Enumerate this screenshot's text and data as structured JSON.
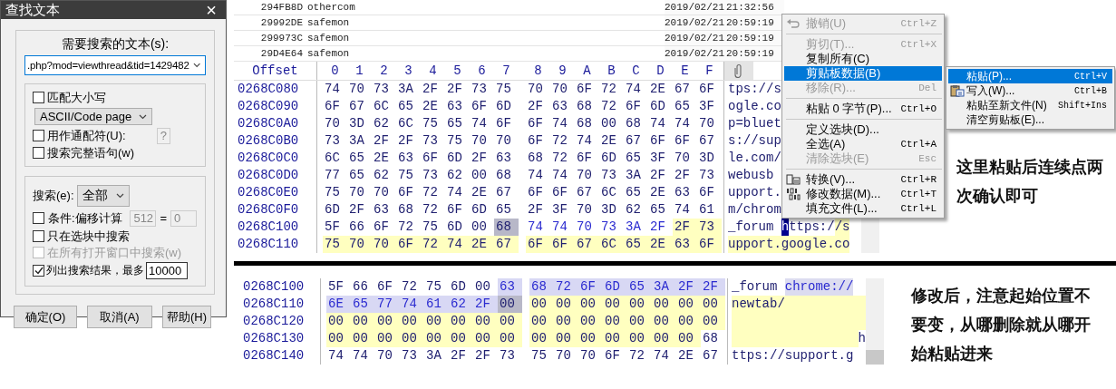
{
  "find_dialog": {
    "title": "查找文本",
    "close": "×",
    "search_label": "需要搜索的文本(s):",
    "search_value": ".php?mod=viewthread&tid=1429482",
    "options": [
      {
        "kind": "checkbox",
        "label": "匹配大小写",
        "checked": false
      },
      {
        "kind": "select",
        "value": "ASCII/Code page"
      },
      {
        "kind": "checkbox_field",
        "label": "用作通配符(U):",
        "checked": false,
        "field": "?"
      },
      {
        "kind": "checkbox",
        "label": "搜索完整语句(w)",
        "checked": false
      }
    ],
    "search_scope": {
      "label": "搜索(e):",
      "value": "全部"
    },
    "scope_options": [
      {
        "kind": "offset",
        "label": "条件:偏移计算",
        "checked": false,
        "disabled": false,
        "field": "512",
        "equals": "=",
        "field2": "0"
      },
      {
        "kind": "checkbox",
        "label": "只在选块中搜索",
        "checked": false,
        "disabled": false
      },
      {
        "kind": "checkbox",
        "label": "在所有打开窗口中搜索(w)",
        "checked": false,
        "disabled": true
      },
      {
        "kind": "limit",
        "label": "列出搜索结果，最多",
        "checked": true,
        "disabled": false,
        "field": "10000"
      }
    ],
    "buttons": [
      "确定(O)",
      "取消(A)",
      "帮助(H)"
    ]
  },
  "hex_top": {
    "results": [
      {
        "offset": "294FB8D",
        "name": "othercom",
        "date": "2019/02/21",
        "time": "21:32:56"
      },
      {
        "offset": "29992DE",
        "name": "safemon",
        "date": "2019/02/21",
        "time": "20:59:19"
      },
      {
        "offset": "299973C",
        "name": "safemon",
        "date": "2019/02/21",
        "time": "20:59:19"
      },
      {
        "offset": "29D4E64",
        "name": "safemon",
        "date": "2019/02/21",
        "time": "20:59:19"
      }
    ],
    "header": {
      "offset": "Offset",
      "columns": [
        "0",
        "1",
        "2",
        "3",
        "4",
        "5",
        "6",
        "7",
        "8",
        "9",
        "A",
        "B",
        "C",
        "D",
        "E",
        "F"
      ]
    },
    "rows": [
      {
        "offset": "0268C080",
        "bytes": [
          "74",
          "70",
          "73",
          "3A",
          "2F",
          "2F",
          "73",
          "75",
          "70",
          "70",
          "6F",
          "72",
          "74",
          "2E",
          "67",
          "6F"
        ],
        "text": [
          {
            "text": "tps://s",
            "kind": "plain"
          }
        ]
      },
      {
        "offset": "0268C090",
        "bytes": [
          "6F",
          "67",
          "6C",
          "65",
          "2E",
          "63",
          "6F",
          "6D",
          "2F",
          "63",
          "68",
          "72",
          "6F",
          "6D",
          "65",
          "3F"
        ],
        "text": [
          {
            "text": "ogle.co",
            "kind": "plain"
          }
        ]
      },
      {
        "offset": "0268C0A0",
        "bytes": [
          "70",
          "3D",
          "62",
          "6C",
          "75",
          "65",
          "74",
          "6F",
          "6F",
          "74",
          "68",
          "00",
          "68",
          "74",
          "74",
          "70"
        ],
        "text": [
          {
            "text": "p=bluet",
            "kind": "plain"
          }
        ]
      },
      {
        "offset": "0268C0B0",
        "bytes": [
          "73",
          "3A",
          "2F",
          "2F",
          "73",
          "75",
          "70",
          "70",
          "6F",
          "72",
          "74",
          "2E",
          "67",
          "6F",
          "6F",
          "67"
        ],
        "text": [
          {
            "text": "s://sup",
            "kind": "plain"
          }
        ]
      },
      {
        "offset": "0268C0C0",
        "bytes": [
          "6C",
          "65",
          "2E",
          "63",
          "6F",
          "6D",
          "2F",
          "63",
          "68",
          "72",
          "6F",
          "6D",
          "65",
          "3F",
          "70",
          "3D"
        ],
        "text": [
          {
            "text": "le.com/",
            "kind": "plain"
          }
        ]
      },
      {
        "offset": "0268C0D0",
        "bytes": [
          "77",
          "65",
          "62",
          "75",
          "73",
          "62",
          "00",
          "68",
          "74",
          "74",
          "70",
          "73",
          "3A",
          "2F",
          "2F",
          "73"
        ],
        "text": [
          {
            "text": "webusb",
            "kind": "plain"
          }
        ]
      },
      {
        "offset": "0268C0E0",
        "bytes": [
          "75",
          "70",
          "70",
          "6F",
          "72",
          "74",
          "2E",
          "67",
          "6F",
          "6F",
          "67",
          "6C",
          "65",
          "2E",
          "63",
          "6F"
        ],
        "text": [
          {
            "text": "upport.",
            "kind": "plain"
          }
        ]
      },
      {
        "offset": "0268C0F0",
        "bytes": [
          "6D",
          "2F",
          "63",
          "68",
          "72",
          "6F",
          "6D",
          "65",
          "2F",
          "3F",
          "70",
          "3D",
          "62",
          "65",
          "74",
          "61"
        ],
        "text": [
          {
            "text": "m/chrom",
            "kind": "plain"
          }
        ]
      },
      {
        "offset": "0268C100",
        "cells": [
          {
            "value": "5F",
            "kind": "plain"
          },
          {
            "value": "66",
            "kind": "plain"
          },
          {
            "value": "6F",
            "kind": "plain"
          },
          {
            "value": "72",
            "kind": "plain"
          },
          {
            "value": "75",
            "kind": "plain"
          },
          {
            "value": "6D",
            "kind": "plain"
          },
          {
            "value": "00",
            "kind": "plain"
          },
          {
            "value": "68",
            "kind": "cursor"
          },
          {
            "value": "74",
            "kind": "marked"
          },
          {
            "value": "74",
            "kind": "marked"
          },
          {
            "value": "70",
            "kind": "marked"
          },
          {
            "value": "73",
            "kind": "marked"
          },
          {
            "value": "3A",
            "kind": "marked"
          },
          {
            "value": "2F",
            "kind": "marked"
          },
          {
            "value": "2F",
            "kind": "modified"
          },
          {
            "value": "73",
            "kind": "modified"
          }
        ],
        "text": [
          {
            "text": "_forum ",
            "kind": "plain"
          },
          {
            "text": "h",
            "kind": "cursor"
          },
          {
            "text": "ttps:/",
            "kind": "plain"
          },
          {
            "text": "/s",
            "kind": "modified"
          }
        ]
      },
      {
        "offset": "0268C110",
        "cells": [
          {
            "value": "75",
            "kind": "modified"
          },
          {
            "value": "70",
            "kind": "modified"
          },
          {
            "value": "70",
            "kind": "modified"
          },
          {
            "value": "6F",
            "kind": "modified"
          },
          {
            "value": "72",
            "kind": "modified"
          },
          {
            "value": "74",
            "kind": "modified"
          },
          {
            "value": "2E",
            "kind": "modified"
          },
          {
            "value": "67",
            "kind": "modified"
          },
          {
            "value": "6F",
            "kind": "modified"
          },
          {
            "value": "6F",
            "kind": "modified"
          },
          {
            "value": "67",
            "kind": "modified"
          },
          {
            "value": "6C",
            "kind": "modified"
          },
          {
            "value": "65",
            "kind": "modified"
          },
          {
            "value": "2E",
            "kind": "modified"
          },
          {
            "value": "63",
            "kind": "modified"
          },
          {
            "value": "6F",
            "kind": "modified"
          }
        ],
        "text": [
          {
            "text": "upport.google.co",
            "kind": "modified"
          }
        ]
      }
    ],
    "note": "这里粘贴后连续点两次确认即可"
  },
  "context_menu": {
    "items": [
      {
        "kind": "undo",
        "label": "撤销(U)",
        "shortcut": "Ctrl+Z",
        "disabled": true,
        "selected": false
      },
      {
        "kind": "separator"
      },
      {
        "kind": "item",
        "label": "剪切(T)...",
        "shortcut": "Ctrl+X",
        "disabled": true,
        "selected": false
      },
      {
        "kind": "item",
        "label": "复制所有(C)",
        "disabled": false,
        "selected": false
      },
      {
        "kind": "item",
        "label": "剪贴板数据(B)",
        "disabled": false,
        "selected": true
      },
      {
        "kind": "item",
        "label": "移除(R)...",
        "shortcut": "Del",
        "disabled": true,
        "selected": false
      },
      {
        "kind": "separator"
      },
      {
        "kind": "item",
        "label": "粘贴 0 字节(P)...",
        "shortcut": "Ctrl+O",
        "disabled": false,
        "selected": false
      },
      {
        "kind": "separator"
      },
      {
        "kind": "item",
        "label": "定义选块(D)...",
        "disabled": false,
        "selected": false
      },
      {
        "kind": "item",
        "label": "全选(A)",
        "shortcut": "Ctrl+A",
        "disabled": false,
        "selected": false
      },
      {
        "kind": "item",
        "label": "清除选块(E)",
        "shortcut": "Esc",
        "disabled": true,
        "selected": false
      },
      {
        "kind": "separator"
      },
      {
        "kind": "convert",
        "label": "转换(V)...",
        "shortcut": "Ctrl+R",
        "disabled": false,
        "selected": false
      },
      {
        "kind": "modify",
        "label": "修改数据(M)...",
        "shortcut": "Ctrl+T",
        "disabled": false,
        "selected": false
      },
      {
        "kind": "item",
        "label": "填充文件(L)...",
        "shortcut": "Ctrl+L",
        "disabled": false,
        "selected": false
      }
    ]
  },
  "clipboard_submenu": {
    "items": [
      {
        "kind": "item",
        "label": "粘贴(P)...",
        "shortcut": "Ctrl+V",
        "disabled": false,
        "selected": true
      },
      {
        "kind": "write",
        "label": "写入(W)...",
        "shortcut": "Ctrl+B",
        "disabled": false,
        "selected": false
      },
      {
        "kind": "item",
        "label": "粘贴至新文件(N)",
        "shortcut": "Shift+Ins",
        "disabled": false,
        "selected": false
      },
      {
        "kind": "item",
        "label": "清空剪贴板(E)...",
        "disabled": false,
        "selected": false
      }
    ]
  },
  "hex_bottom": {
    "rows": [
      {
        "offset": "0268C100",
        "cells": [
          {
            "value": "5F",
            "kind": "plain"
          },
          {
            "value": "66",
            "kind": "plain"
          },
          {
            "value": "6F",
            "kind": "plain"
          },
          {
            "value": "72",
            "kind": "plain"
          },
          {
            "value": "75",
            "kind": "plain"
          },
          {
            "value": "6D",
            "kind": "plain"
          },
          {
            "value": "00",
            "kind": "plain"
          },
          {
            "value": "63",
            "kind": "selected"
          },
          {
            "value": "68",
            "kind": "selected"
          },
          {
            "value": "72",
            "kind": "selected"
          },
          {
            "value": "6F",
            "kind": "selected"
          },
          {
            "value": "6D",
            "kind": "selected"
          },
          {
            "value": "65",
            "kind": "selected"
          },
          {
            "value": "3A",
            "kind": "selected"
          },
          {
            "value": "2F",
            "kind": "selected"
          },
          {
            "value": "2F",
            "kind": "selected"
          }
        ],
        "text": [
          {
            "text": "_forum ",
            "kind": "plain"
          },
          {
            "text": "chrome://",
            "kind": "selected"
          }
        ]
      },
      {
        "offset": "0268C110",
        "cells": [
          {
            "value": "6E",
            "kind": "selected"
          },
          {
            "value": "65",
            "kind": "selected"
          },
          {
            "value": "77",
            "kind": "selected"
          },
          {
            "value": "74",
            "kind": "selected"
          },
          {
            "value": "61",
            "kind": "selected"
          },
          {
            "value": "62",
            "kind": "selected"
          },
          {
            "value": "2F",
            "kind": "selected"
          },
          {
            "value": "00",
            "kind": "cursor"
          },
          {
            "value": "00",
            "kind": "modified"
          },
          {
            "value": "00",
            "kind": "modified"
          },
          {
            "value": "00",
            "kind": "modified"
          },
          {
            "value": "00",
            "kind": "modified"
          },
          {
            "value": "00",
            "kind": "modified"
          },
          {
            "value": "00",
            "kind": "modified"
          },
          {
            "value": "00",
            "kind": "modified"
          },
          {
            "value": "00",
            "kind": "modified"
          }
        ],
        "text": [
          {
            "text": "newtab/",
            "kind": "modified"
          }
        ],
        "fill": {
          "kind": "after"
        }
      },
      {
        "offset": "0268C120",
        "cells": [
          {
            "value": "00",
            "kind": "modified"
          },
          {
            "value": "00",
            "kind": "modified"
          },
          {
            "value": "00",
            "kind": "modified"
          },
          {
            "value": "00",
            "kind": "modified"
          },
          {
            "value": "00",
            "kind": "modified"
          },
          {
            "value": "00",
            "kind": "modified"
          },
          {
            "value": "00",
            "kind": "modified"
          },
          {
            "value": "00",
            "kind": "modified"
          },
          {
            "value": "00",
            "kind": "modified"
          },
          {
            "value": "00",
            "kind": "modified"
          },
          {
            "value": "00",
            "kind": "modified"
          },
          {
            "value": "00",
            "kind": "modified"
          },
          {
            "value": "00",
            "kind": "modified"
          },
          {
            "value": "00",
            "kind": "modified"
          },
          {
            "value": "00",
            "kind": "modified"
          },
          {
            "value": "00",
            "kind": "modified"
          }
        ],
        "fill": {
          "kind": "full"
        }
      },
      {
        "offset": "0268C130",
        "cells": [
          {
            "value": "00",
            "kind": "modified"
          },
          {
            "value": "00",
            "kind": "modified"
          },
          {
            "value": "00",
            "kind": "modified"
          },
          {
            "value": "00",
            "kind": "modified"
          },
          {
            "value": "00",
            "kind": "modified"
          },
          {
            "value": "00",
            "kind": "modified"
          },
          {
            "value": "00",
            "kind": "modified"
          },
          {
            "value": "00",
            "kind": "modified"
          },
          {
            "value": "00",
            "kind": "modified"
          },
          {
            "value": "00",
            "kind": "modified"
          },
          {
            "value": "00",
            "kind": "modified"
          },
          {
            "value": "00",
            "kind": "modified"
          },
          {
            "value": "00",
            "kind": "modified"
          },
          {
            "value": "00",
            "kind": "modified"
          },
          {
            "value": "00",
            "kind": "modified"
          },
          {
            "value": "68",
            "kind": "plain"
          }
        ],
        "text": [
          {
            "text": "h",
            "kind": "plain"
          }
        ],
        "fill": {
          "kind": "before"
        }
      },
      {
        "offset": "0268C140",
        "bytes": [
          "74",
          "74",
          "70",
          "73",
          "3A",
          "2F",
          "2F",
          "73",
          "75",
          "70",
          "70",
          "6F",
          "72",
          "74",
          "2E",
          "67"
        ],
        "text": [
          {
            "text": "ttps://support.g",
            "kind": "plain"
          }
        ]
      }
    ],
    "note": "修改后，注意起始位置不要变，从哪删除就从哪开始粘贴进来"
  }
}
